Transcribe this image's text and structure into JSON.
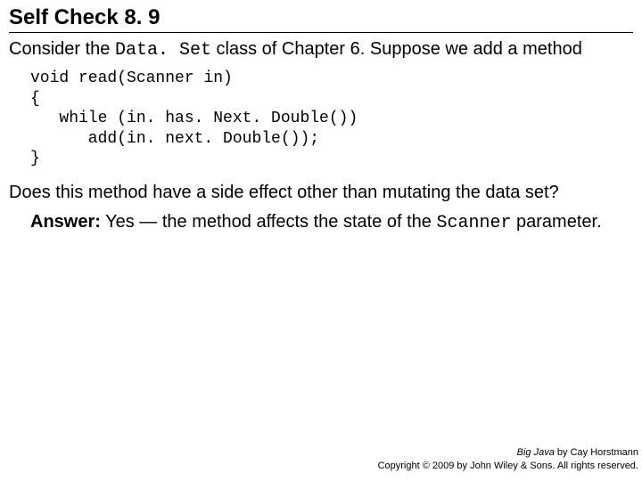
{
  "title": "Self Check 8. 9",
  "intro_pre": "Consider the ",
  "intro_code": "Data. Set",
  "intro_post": " class of Chapter 6. Suppose we add a method",
  "code": "void read(Scanner in)\n{\n   while (in. has. Next. Double())\n      add(in. next. Double());\n}",
  "question": "Does this method have a side effect other than mutating the data set?",
  "answer_label": "Answer:",
  "answer_pre": " Yes — the method affects the state of the ",
  "answer_code": "Scanner",
  "answer_post": " parameter.",
  "footer_book": "Big Java",
  "footer_by": " by  Cay Horstmann",
  "footer_copy": "Copyright © 2009 by John Wiley & Sons.  All rights reserved."
}
